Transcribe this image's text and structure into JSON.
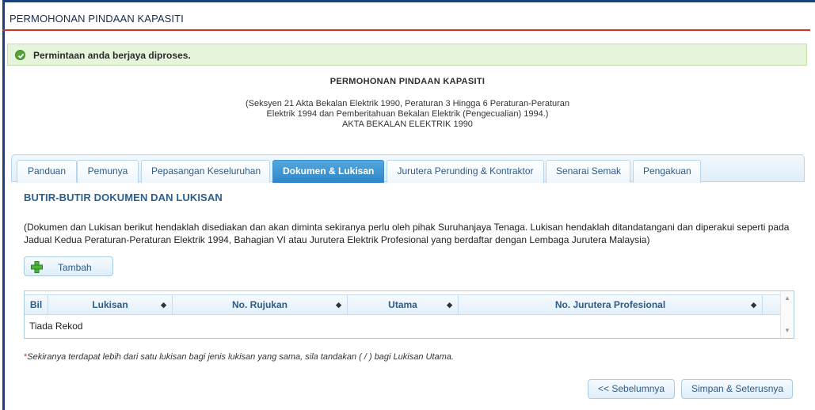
{
  "header": {
    "title": "PERMOHONAN PINDAAN KAPASITI"
  },
  "alert": {
    "message": "Permintaan anda berjaya diproses.",
    "icon": "check-circle-icon",
    "color": "#58a339"
  },
  "form": {
    "title": "PERMOHONAN PINDAAN KAPASITI",
    "subtitle_lines": [
      "(Seksyen 21 Akta Bekalan Elektrik 1990, Peraturan 3 Hingga 6 Peraturan-Peraturan",
      "Elektrik 1994 dan Pemberitahuan Bekalan Elektrik (Pengecualian) 1994.)",
      "AKTA BEKALAN ELEKTRIK 1990"
    ]
  },
  "tabs": [
    {
      "label": "Panduan",
      "active": false
    },
    {
      "label": "Pemunya",
      "active": false
    },
    {
      "label": "Pepasangan Keseluruhan",
      "active": false
    },
    {
      "label": "Dokumen & Lukisan",
      "active": true
    },
    {
      "label": "Jurutera Perunding & Kontraktor",
      "active": false
    },
    {
      "label": "Senarai Semak",
      "active": false
    },
    {
      "label": "Pengakuan",
      "active": false
    }
  ],
  "section": {
    "title": "BUTIR-BUTIR DOKUMEN DAN LUKISAN",
    "description": "(Dokumen dan Lukisan berikut hendaklah disediakan dan akan diminta sekiranya perlu oleh pihak Suruhanjaya Tenaga. Lukisan hendaklah ditandatangani dan diperakui seperti pada Jadual Kedua Peraturan-Peraturan Elektrik 1994, Bahagian VI atau Jurutera Elektrik Profesional yang berdaftar dengan Lembaga Jurutera Malaysia)"
  },
  "add_button": {
    "label": "Tambah",
    "icon": "plus-icon"
  },
  "table": {
    "columns": [
      "Bil",
      "Lukisan",
      "No. Rujukan",
      "Utama",
      "No. Jurutera Profesional"
    ],
    "empty_text": "Tiada Rekod"
  },
  "note": {
    "asterisk": "*",
    "text": "Sekiranya terdapat lebih dari satu lukisan bagi jenis lukisan yang sama, sila tandakan ( / ) bagi Lukisan Utama."
  },
  "nav": {
    "prev_label": "<< Sebelumnya",
    "next_label": "Simpan & Seterusnya"
  },
  "colors": {
    "accent": "#2e86c9",
    "header_rule": "#d9302c",
    "frame": "#1c3f7a"
  }
}
